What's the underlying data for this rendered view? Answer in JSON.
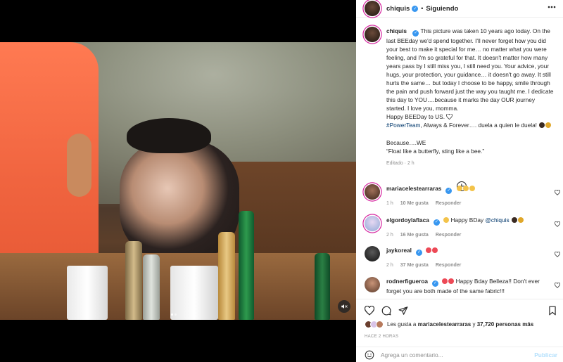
{
  "post": {
    "username": "chiquis",
    "follow_status": "Siguiendo",
    "separator": "•",
    "verified_mark": "✓"
  },
  "caption": {
    "username": "chiquis",
    "text_main": "This picture was taken 10 years ago today. On the last BEEday we'd spend together. I'll never forget how you did your best to make it special for me… no matter what you were feeling, and I'm so grateful for that. It doesn't matter how many years pass by I still miss you, I still need you. Your advice, your hugs, your protection, your guidance… it doesn't go away. It still hurts the same… but today I choose to be happy, smile through the pain and push forward just the way you taught me. I dedicate this day to YOU….because it marks the day OUR journey started. I love you, momma.",
    "text_line2": "Happy BEEDay to US.",
    "hashtag": "#PowerTeam",
    "text_line3": ", Always & Forever…. duela a quien le duela!",
    "text_line4": "Because….WE",
    "text_line5": "“Float like a butterfly, sting like a bee.”",
    "edited": "Editado · 2 h"
  },
  "comments": [
    {
      "username": "mariacelestearraras",
      "text": "",
      "time": "1 h",
      "likes": "10 Me gusta",
      "reply": "Responder"
    },
    {
      "username": "elgordoylaflaca",
      "text": "Happy BDay",
      "mention": "@chiquis",
      "time": "2 h",
      "likes": "16 Me gusta",
      "reply": "Responder"
    },
    {
      "username": "jaykoreal",
      "text": "",
      "time": "2 h",
      "likes": "37 Me gusta",
      "reply": "Responder"
    },
    {
      "username": "rodnerfigueroa",
      "text": "Happy Bday Belleza!! Don't ever forget you are both made of the same fabric!!!"
    }
  ],
  "likes": {
    "prefix": "Les gusta a",
    "user": "mariacelestearraras",
    "middle": "y",
    "count": "37,720 personas más"
  },
  "timestamp": "HACE 2 HORAS",
  "comment_box": {
    "placeholder": "Agrega un comentario...",
    "publish": "Publicar"
  },
  "icons": [
    "more-icon",
    "heart-icon",
    "comment-icon",
    "share-icon",
    "bookmark-icon",
    "emoji-icon",
    "add-comment-icon",
    "mute-icon",
    "verified-icon"
  ],
  "colors": {
    "accent": "#3897f0",
    "link": "#00376b",
    "muted": "#8e8e8e",
    "heart": "#ed4956",
    "publish": "#b2dffc"
  }
}
